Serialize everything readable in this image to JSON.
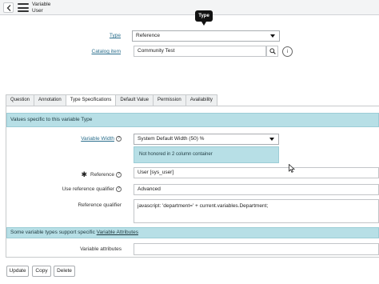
{
  "header": {
    "title_line1": "Variable",
    "title_line2": "User"
  },
  "tooltip": "Type",
  "top_form": {
    "type_label": "Type",
    "type_value": "Reference",
    "catalog_item_label": "Catalog item",
    "catalog_item_value": "Community Test"
  },
  "tabs": [
    "Question",
    "Annotation",
    "Type Specifications",
    "Default Value",
    "Permission",
    "Availability"
  ],
  "active_tab": "Type Specifications",
  "type_spec": {
    "info_prefix": "Values specific to this variable ",
    "info_type": "Type",
    "variable_width_label": "Variable Width",
    "variable_width_value": "System Default Width (50) %",
    "width_notice": "Not honored in 2 column container",
    "reference_label": "Reference",
    "reference_value": "User [sys_user]",
    "qualifier_label": "Use reference qualifier",
    "qualifier_value": "Advanced",
    "ref_qual_label": "Reference qualifier",
    "ref_qual_value": "javascript: 'department=' + current.variables.Department;",
    "attributes_info_prefix": "Some variable types support specific ",
    "attributes_info_link": "Variable Attributes",
    "attributes_label": "Variable attributes",
    "attributes_value": ""
  },
  "buttons": {
    "update": "Update",
    "copy": "Copy",
    "delete": "Delete"
  },
  "colors": {
    "link": "#2a6e8c",
    "info_bg": "#b7dfe6",
    "header_bg": "#f3f4f5"
  }
}
